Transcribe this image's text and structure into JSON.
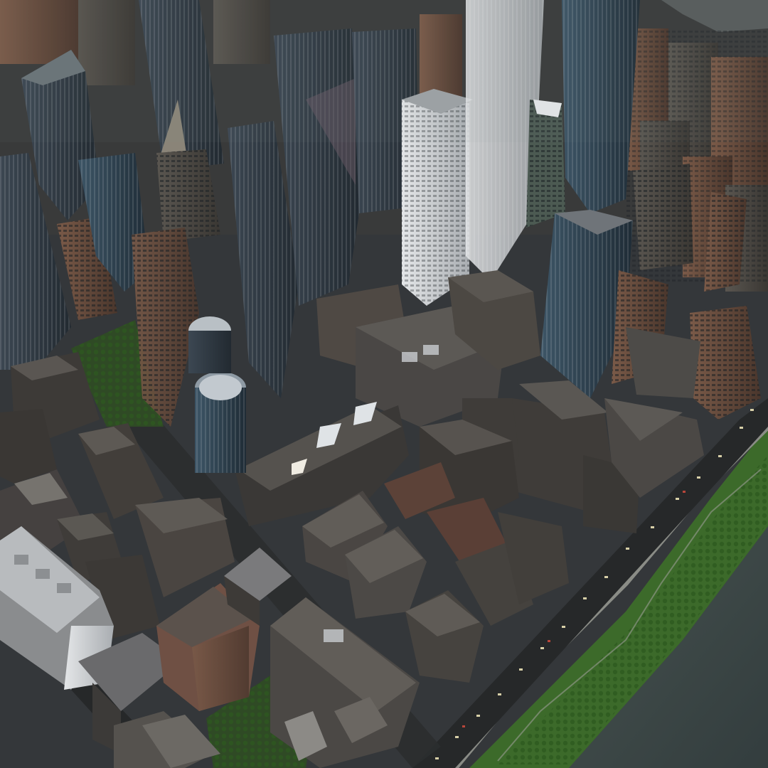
{
  "scene": {
    "subject": "aerial-city",
    "colors": {
      "sky_haze": "#3a3f44",
      "ground": "#34373a",
      "road": "#2a2c2e",
      "water": "#3b4648",
      "park": "#2f4a25",
      "riverbank_grass": "#3d6a2a",
      "walkway": "#8a8c86",
      "tower_glass": "#4a5560",
      "tower_glass_dark": "#2c333b",
      "tower_white": "#d8dcde",
      "tower_brown": "#6a4f40",
      "roof_flat": "#4c4a47",
      "roof_light": "#8a8884",
      "car": "#d8d0a8"
    }
  }
}
